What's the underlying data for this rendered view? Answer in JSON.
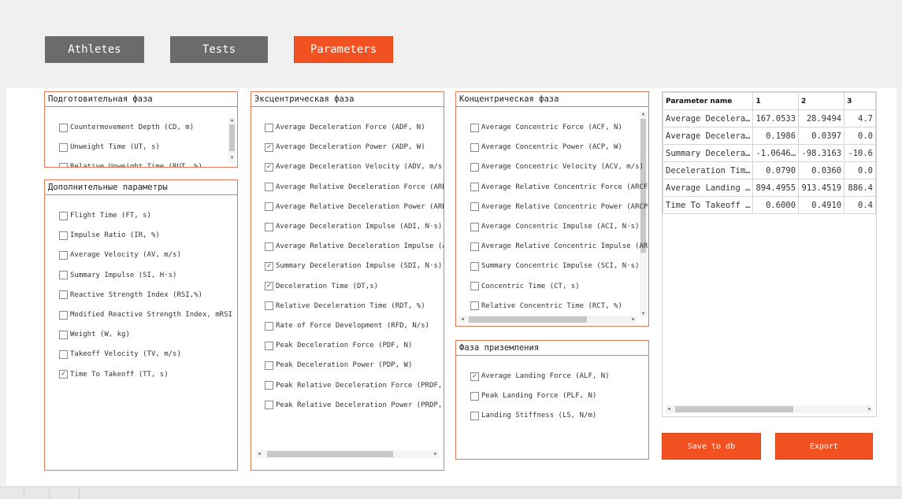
{
  "tabs": [
    {
      "label": "Athletes"
    },
    {
      "label": "Tests"
    },
    {
      "label": "Parameters"
    }
  ],
  "groups": {
    "preparatory": {
      "title": "Подготовительная фаза",
      "items": [
        {
          "label": "Countermovement Depth (CD, m)",
          "checked": false
        },
        {
          "label": "Unweight Time (UT, s)",
          "checked": false
        },
        {
          "label": "Relative Unweight Time (RUT, %)",
          "checked": false
        }
      ]
    },
    "additional": {
      "title": "Дополнительные параметры",
      "items": [
        {
          "label": "Flight Time (FT, s)",
          "checked": false
        },
        {
          "label": "Impulse Ratio (IR, %)",
          "checked": false
        },
        {
          "label": "Average Velocity (AV, m/s)",
          "checked": false
        },
        {
          "label": "Summary Impulse (SI, H·s)",
          "checked": false
        },
        {
          "label": "Reactive Strength Index (RSI,%)",
          "checked": false
        },
        {
          "label": "Modified Reactive Strength Index, mRSI",
          "checked": false
        },
        {
          "label": "Weight (W, kg)",
          "checked": false
        },
        {
          "label": "Takeoff Velocity (TV, m/s)",
          "checked": false
        },
        {
          "label": "Time To Takeoff (TT, s)",
          "checked": true
        }
      ]
    },
    "eccentric": {
      "title": "Эксцентрическая фаза",
      "items": [
        {
          "label": "Average Deceleration Force (ADF, N)",
          "checked": false
        },
        {
          "label": "Average Deceleration Power (ADP, W)",
          "checked": true
        },
        {
          "label": "Average Deceleration Velocity (ADV, m/s)",
          "checked": true
        },
        {
          "label": "Average Relative Deceleration Force (ARDF, %)",
          "checked": false
        },
        {
          "label": "Average Relative Deceleration Power (ARDP, %)",
          "checked": false
        },
        {
          "label": "Average Deceleration Impulse (ADI, N·s)",
          "checked": false
        },
        {
          "label": "Average Relative Deceleration Impulse (ARDI, %)",
          "checked": false
        },
        {
          "label": "Summary Deceleration Impulse (SDI, N·s)",
          "checked": true
        },
        {
          "label": "Deceleration Time (DT,s)",
          "checked": true
        },
        {
          "label": "Relative Deceleration Time (RDT, %)",
          "checked": false
        },
        {
          "label": "Rate of Force Development (RFD, N/s)",
          "checked": false
        },
        {
          "label": "Peak Deceleration Force (PDF, N)",
          "checked": false
        },
        {
          "label": "Peak Deceleration Power (PDP, W)",
          "checked": false
        },
        {
          "label": "Peak Relative Deceleration Force (PRDF, %)",
          "checked": false
        },
        {
          "label": "Peak Relative Deceleration Power (PRDP, %)",
          "checked": false
        }
      ]
    },
    "concentric": {
      "title": "Концентрическая фаза",
      "items": [
        {
          "label": "Average Concentric Force (ACF, N)",
          "checked": false
        },
        {
          "label": "Average Concentric Power (ACP, W)",
          "checked": false
        },
        {
          "label": "Average Concentric Velocity (ACV, m/s)",
          "checked": false
        },
        {
          "label": "Average Relative Concentric Force (ARCF, %)",
          "checked": false
        },
        {
          "label": "Average Relative Concentric Power (ARCP, %)",
          "checked": false
        },
        {
          "label": "Average Concentric Impulse (ACI, N·s)",
          "checked": false
        },
        {
          "label": "Average Relative Concentric Impulse (ARCI, %)",
          "checked": false
        },
        {
          "label": "Summary Concentric Impulse (SCI, N·s)",
          "checked": false
        },
        {
          "label": "Concentric Time (CT, s)",
          "checked": false
        },
        {
          "label": "Relative Concentric Time (RCT, %)",
          "checked": false
        }
      ]
    },
    "landing": {
      "title": "Фаза приземления",
      "items": [
        {
          "label": "Average Landing Force (ALF, N)",
          "checked": true
        },
        {
          "label": "Peak Landing Force (PLF, N)",
          "checked": false
        },
        {
          "label": "Landing Stiffness (LS, N/m)",
          "checked": false
        }
      ]
    }
  },
  "table": {
    "headers": [
      "Parameter name",
      "1",
      "2",
      "3"
    ],
    "rows": [
      [
        "Average Decelera…",
        "167.0533",
        "28.9494",
        "4.7"
      ],
      [
        "Average Decelera…",
        "0.1986",
        "0.0397",
        "0.0"
      ],
      [
        "Summary Decelera…",
        "-1.0646…",
        "-98.3163",
        "-10.6"
      ],
      [
        "Deceleration Tim…",
        "0.0790",
        "0.0360",
        "0.0"
      ],
      [
        "Average Landing …",
        "894.4955",
        "913.4519",
        "886.4"
      ],
      [
        "Time To Takeoff …",
        "0.6000",
        "0.4910",
        "0.4"
      ]
    ]
  },
  "buttons": {
    "save": "Save to db",
    "export": "Export"
  },
  "colors": {
    "accent": "#f25222",
    "tab_gray": "#6b6b6b",
    "group_border": "#e27a58"
  }
}
